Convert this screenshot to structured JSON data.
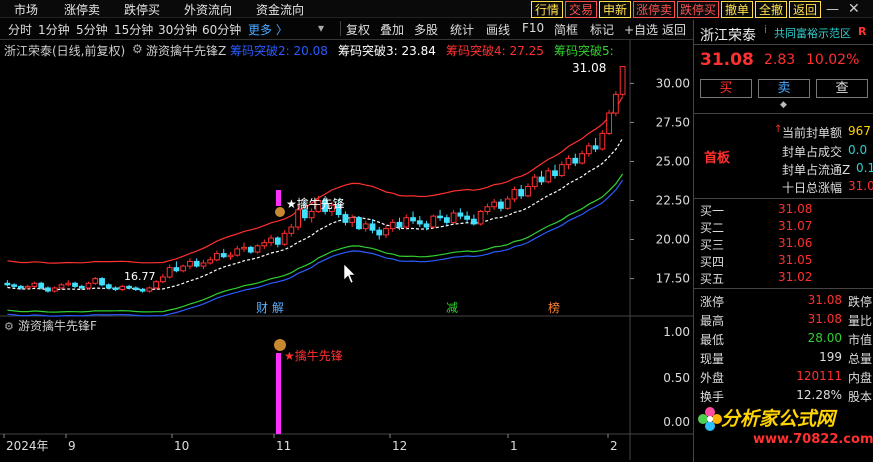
{
  "top_menu": [
    "市场",
    "涨停卖",
    "跌停买",
    "外资流向",
    "资金流向"
  ],
  "toolbar": {
    "periods": [
      "分时",
      "1分钟",
      "5分钟",
      "15分钟",
      "30分钟",
      "60分钟"
    ],
    "more": "更多 〉",
    "tools": [
      "复权",
      "叠加",
      "多股",
      "统计",
      "画线",
      "F10",
      "简框",
      "标记",
      "+自选",
      "返回"
    ],
    "trade_buttons": [
      {
        "label": "行情",
        "color": "#ffe04a"
      },
      {
        "label": "交易",
        "color": "#ff5050"
      },
      {
        "label": "申新",
        "color": "#ffe04a"
      },
      {
        "label": "涨停卖",
        "color": "#ff5050"
      },
      {
        "label": "跌停买",
        "color": "#ff5050"
      },
      {
        "label": "撤单",
        "color": "#ffe04a"
      },
      {
        "label": "全撤",
        "color": "#ffe04a"
      },
      {
        "label": "返回",
        "color": "#ffe04a"
      }
    ]
  },
  "main_chart": {
    "stock_label": "浙江荣泰(日线,前复权)",
    "indicator_name": "游资擒牛先锋Z",
    "indicators": [
      {
        "label": "筹码突破2: 20.08",
        "color": "#2a5cff"
      },
      {
        "label": "筹码突破3: 23.84",
        "color": "#ffffff"
      },
      {
        "label": "筹码突破4: 27.25",
        "color": "#ff3030"
      },
      {
        "label": "筹码突破5:",
        "color": "#30d030"
      }
    ],
    "price_axis": [
      "30.00",
      "27.50",
      "25.00",
      "22.50",
      "20.00",
      "17.50"
    ],
    "last_price_label": "31.08",
    "low_price_label": "16.77",
    "signal_label": "★擒牛先锋",
    "event_markers": [
      {
        "text": "财",
        "color": "#5ab0ff"
      },
      {
        "text": "解",
        "color": "#5ab0ff"
      },
      {
        "text": "减",
        "color": "#30d030"
      },
      {
        "text": "榜",
        "color": "#ff8030"
      }
    ]
  },
  "sub_chart": {
    "indicator_name": "游资擒牛先锋F",
    "axis": [
      "1.00",
      "0.50",
      "0.00"
    ],
    "signal_label": "★擒牛先锋"
  },
  "time_axis": [
    "2024年",
    "9",
    "10",
    "11",
    "12",
    "1",
    "2"
  ],
  "chart_data": {
    "type": "candlestick",
    "ohlc": [
      [
        17.2,
        17.4,
        17.0,
        17.1
      ],
      [
        17.1,
        17.2,
        16.9,
        17.0
      ],
      [
        17.0,
        17.1,
        16.8,
        16.9
      ],
      [
        16.9,
        17.1,
        16.8,
        17.0
      ],
      [
        17.0,
        17.3,
        16.9,
        17.2
      ],
      [
        17.2,
        17.3,
        16.8,
        16.9
      ],
      [
        16.9,
        17.0,
        16.6,
        16.7
      ],
      [
        16.7,
        17.0,
        16.6,
        16.9
      ],
      [
        16.9,
        17.2,
        16.8,
        17.1
      ],
      [
        17.1,
        17.4,
        17.0,
        17.2
      ],
      [
        17.2,
        17.3,
        16.9,
        17.0
      ],
      [
        17.0,
        17.1,
        16.8,
        16.9
      ],
      [
        16.9,
        17.3,
        16.8,
        17.2
      ],
      [
        17.2,
        17.6,
        17.1,
        17.5
      ],
      [
        17.5,
        17.6,
        17.0,
        17.1
      ],
      [
        17.1,
        17.2,
        16.8,
        16.9
      ],
      [
        16.9,
        17.0,
        16.7,
        16.8
      ],
      [
        16.8,
        17.1,
        16.7,
        17.0
      ],
      [
        17.0,
        17.1,
        16.8,
        16.9
      ],
      [
        16.9,
        17.0,
        16.7,
        16.8
      ],
      [
        16.8,
        16.9,
        16.6,
        16.7
      ],
      [
        16.7,
        17.0,
        16.6,
        16.9
      ],
      [
        16.9,
        17.4,
        16.8,
        17.3
      ],
      [
        17.3,
        17.8,
        17.2,
        17.6
      ],
      [
        17.6,
        18.4,
        17.5,
        18.2
      ],
      [
        18.2,
        18.6,
        17.9,
        18.0
      ],
      [
        18.0,
        18.4,
        17.9,
        18.3
      ],
      [
        18.3,
        18.8,
        18.1,
        18.6
      ],
      [
        18.6,
        18.8,
        18.2,
        18.3
      ],
      [
        18.3,
        18.7,
        18.1,
        18.5
      ],
      [
        18.5,
        18.9,
        18.4,
        18.7
      ],
      [
        18.7,
        19.3,
        18.6,
        19.1
      ],
      [
        19.1,
        19.4,
        18.8,
        18.9
      ],
      [
        18.9,
        19.2,
        18.7,
        19.0
      ],
      [
        19.0,
        19.6,
        18.9,
        19.4
      ],
      [
        19.4,
        19.8,
        19.2,
        19.5
      ],
      [
        19.5,
        19.6,
        19.1,
        19.2
      ],
      [
        19.2,
        19.7,
        19.1,
        19.6
      ],
      [
        19.6,
        20.0,
        19.4,
        19.8
      ],
      [
        19.8,
        20.3,
        19.6,
        20.1
      ],
      [
        20.1,
        20.2,
        19.5,
        19.7
      ],
      [
        19.7,
        20.6,
        19.6,
        20.4
      ],
      [
        20.4,
        21.0,
        20.2,
        20.8
      ],
      [
        20.8,
        22.2,
        20.6,
        21.9
      ],
      [
        21.9,
        22.5,
        21.2,
        21.4
      ],
      [
        21.4,
        22.0,
        21.1,
        21.8
      ],
      [
        21.8,
        22.8,
        21.7,
        22.5
      ],
      [
        22.5,
        22.8,
        21.6,
        21.8
      ],
      [
        21.8,
        22.4,
        21.5,
        22.2
      ],
      [
        22.2,
        22.6,
        21.4,
        21.6
      ],
      [
        21.6,
        21.8,
        20.9,
        21.1
      ],
      [
        21.1,
        21.6,
        20.8,
        21.4
      ],
      [
        21.4,
        21.5,
        20.6,
        20.7
      ],
      [
        20.7,
        21.2,
        20.5,
        21.0
      ],
      [
        21.0,
        21.3,
        20.4,
        20.6
      ],
      [
        20.6,
        20.8,
        20.0,
        20.3
      ],
      [
        20.3,
        20.9,
        20.1,
        20.7
      ],
      [
        20.7,
        21.3,
        20.5,
        21.1
      ],
      [
        21.1,
        21.4,
        20.6,
        20.8
      ],
      [
        20.8,
        21.6,
        20.7,
        21.4
      ],
      [
        21.4,
        21.8,
        21.0,
        21.2
      ],
      [
        21.2,
        21.5,
        20.8,
        21.0
      ],
      [
        21.0,
        21.2,
        20.6,
        20.8
      ],
      [
        20.8,
        21.6,
        20.7,
        21.5
      ],
      [
        21.5,
        21.9,
        21.2,
        21.4
      ],
      [
        21.4,
        21.6,
        20.9,
        21.1
      ],
      [
        21.1,
        21.9,
        21.0,
        21.7
      ],
      [
        21.7,
        22.0,
        21.3,
        21.5
      ],
      [
        21.5,
        21.8,
        21.1,
        21.3
      ],
      [
        21.3,
        21.6,
        20.9,
        21.0
      ],
      [
        21.0,
        21.9,
        20.9,
        21.8
      ],
      [
        21.8,
        22.3,
        21.6,
        22.1
      ],
      [
        22.1,
        22.6,
        21.9,
        22.4
      ],
      [
        22.4,
        22.6,
        21.8,
        22.0
      ],
      [
        22.0,
        22.8,
        21.9,
        22.6
      ],
      [
        22.6,
        23.4,
        22.4,
        23.2
      ],
      [
        23.2,
        23.5,
        22.6,
        22.8
      ],
      [
        22.8,
        23.6,
        22.7,
        23.4
      ],
      [
        23.4,
        24.2,
        23.2,
        24.0
      ],
      [
        24.0,
        24.4,
        23.5,
        23.7
      ],
      [
        23.7,
        24.6,
        23.6,
        24.4
      ],
      [
        24.4,
        24.8,
        23.9,
        24.1
      ],
      [
        24.1,
        25.0,
        24.0,
        24.8
      ],
      [
        24.8,
        25.4,
        24.5,
        25.2
      ],
      [
        25.2,
        25.5,
        24.7,
        24.9
      ],
      [
        24.9,
        25.7,
        24.8,
        25.5
      ],
      [
        25.5,
        26.2,
        25.3,
        26.0
      ],
      [
        26.0,
        26.5,
        25.6,
        25.8
      ],
      [
        25.8,
        27.0,
        25.7,
        26.8
      ],
      [
        26.8,
        28.3,
        26.7,
        28.1
      ],
      [
        28.1,
        29.5,
        27.9,
        29.3
      ],
      [
        29.3,
        31.08,
        29.2,
        31.08
      ]
    ],
    "overlay_series": [
      {
        "name": "筹码突破2",
        "color": "#2a5cff"
      },
      {
        "name": "筹码突破3",
        "color": "#ffffff"
      },
      {
        "name": "筹码突破4",
        "color": "#ff3030"
      },
      {
        "name": "筹码突破5",
        "color": "#30d030"
      }
    ],
    "ylim": [
      16.0,
      31.5
    ]
  },
  "quote_panel": {
    "name": "浙江荣泰",
    "broker": "共同富裕示范区",
    "broker_tag": "R",
    "price": "31.08",
    "change": "2.83",
    "change_pct": "10.02%",
    "buttons": [
      "买",
      "卖",
      "查"
    ],
    "board_label": "首板",
    "stats": [
      {
        "label": "当前封单额",
        "value": "967"
      },
      {
        "label": "封单占成交",
        "value": "0.0"
      },
      {
        "label": "封单占流通Z",
        "value": "0.1"
      },
      {
        "label": "十日总涨幅",
        "value": "31.0"
      }
    ],
    "bids": [
      {
        "label": "买一",
        "price": "31.08"
      },
      {
        "label": "买二",
        "price": "31.07"
      },
      {
        "label": "买三",
        "price": "31.06"
      },
      {
        "label": "买四",
        "price": "31.05"
      },
      {
        "label": "买五",
        "price": "31.02"
      }
    ],
    "details": [
      {
        "l1": "涨停",
        "v1": "31.08",
        "l2": "跌停",
        "c1": "#ff3030"
      },
      {
        "l1": "最高",
        "v1": "31.08",
        "l2": "量比",
        "c1": "#ff3030"
      },
      {
        "l1": "最低",
        "v1": "28.00",
        "l2": "市值",
        "c1": "#30d030"
      },
      {
        "l1": "现量",
        "v1": "199",
        "l2": "总量",
        "c1": "#dddddd"
      },
      {
        "l1": "外盘",
        "v1": "120111",
        "l2": "内盘",
        "c1": "#ff3030"
      },
      {
        "l1": "换手",
        "v1": "12.28%",
        "l2": "股本",
        "c1": "#dddddd"
      }
    ]
  },
  "watermark": {
    "text": "分析家公式网",
    "url": "www.70822.com"
  }
}
